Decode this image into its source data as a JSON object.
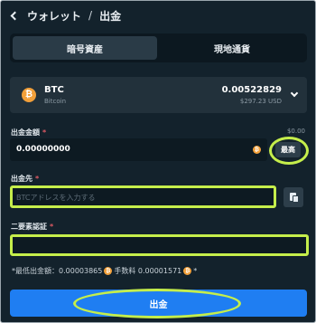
{
  "breadcrumb": {
    "parent": "ウォレット",
    "separator": "/",
    "current": "出金"
  },
  "tabs": [
    {
      "label": "暗号資産",
      "active": true
    },
    {
      "label": "現地通貨",
      "active": false
    }
  ],
  "asset": {
    "coin_letter": "₿",
    "symbol": "BTC",
    "name": "Bitcoin",
    "balance": "0.00522829",
    "balance_usd": "$297.23 USD"
  },
  "amount": {
    "label": "出金金額",
    "required_mark": "*",
    "available": "$0.00",
    "value": "0.00000000",
    "max_label": "最高"
  },
  "address": {
    "label": "出金先",
    "required_mark": "*",
    "placeholder": "BTCアドレスを入力する"
  },
  "twofa": {
    "label": "二要素認証",
    "required_mark": "*"
  },
  "note": {
    "prefix": "*最低出金額：",
    "min_amount": "0.00003865",
    "fee_label": "手数料",
    "fee_amount": "0.00001571",
    "suffix": "*"
  },
  "submit_label": "出金",
  "colors": {
    "background": "#13222c",
    "accent": "#1f7ef2",
    "highlight": "#c5ee4b",
    "btc": "#f2a03a"
  }
}
